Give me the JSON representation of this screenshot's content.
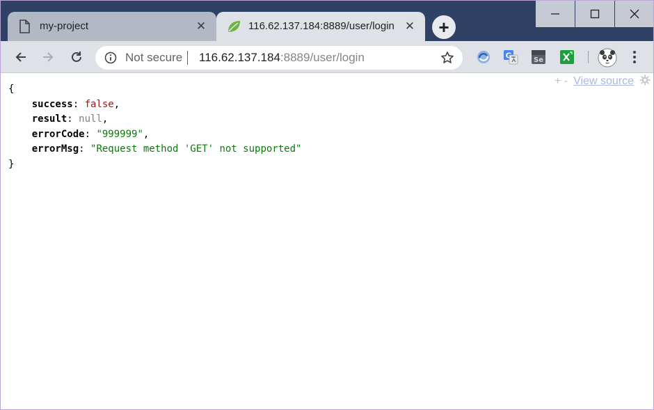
{
  "tabs": [
    {
      "title": "my-project",
      "active": false
    },
    {
      "title": "116.62.137.184:8889/user/login",
      "active": true
    }
  ],
  "omnibox": {
    "security_label": "Not secure",
    "url_host": "116.62.137.184",
    "url_rest": ":8889/user/login"
  },
  "json_view": {
    "open_brace": "{",
    "close_brace": "}",
    "entries": [
      {
        "key": "success",
        "value": "false",
        "type": "bool",
        "suffix": ","
      },
      {
        "key": "result",
        "value": "null",
        "type": "null",
        "suffix": ","
      },
      {
        "key": "errorCode",
        "value": "\"999999\"",
        "type": "str",
        "suffix": ","
      },
      {
        "key": "errorMsg",
        "value": "\"Request method 'GET' not supported\"",
        "type": "str",
        "suffix": ""
      }
    ]
  },
  "viewer_controls": {
    "expand_collapse": "+ -",
    "view_source": "View source"
  },
  "colors": {
    "titlebar": "#2f4266",
    "toolbar": "#dee1e6",
    "json_bool": "#a31515",
    "json_string": "#0b7a0b",
    "json_null": "#808080"
  },
  "icons": {
    "inactive_tab": "page-icon",
    "active_tab": "spring-leaf-icon",
    "extensions": [
      "edge-sync-icon",
      "google-translate-icon",
      "selenium-icon",
      "excel-icon"
    ],
    "profile": "panda-avatar-icon"
  }
}
